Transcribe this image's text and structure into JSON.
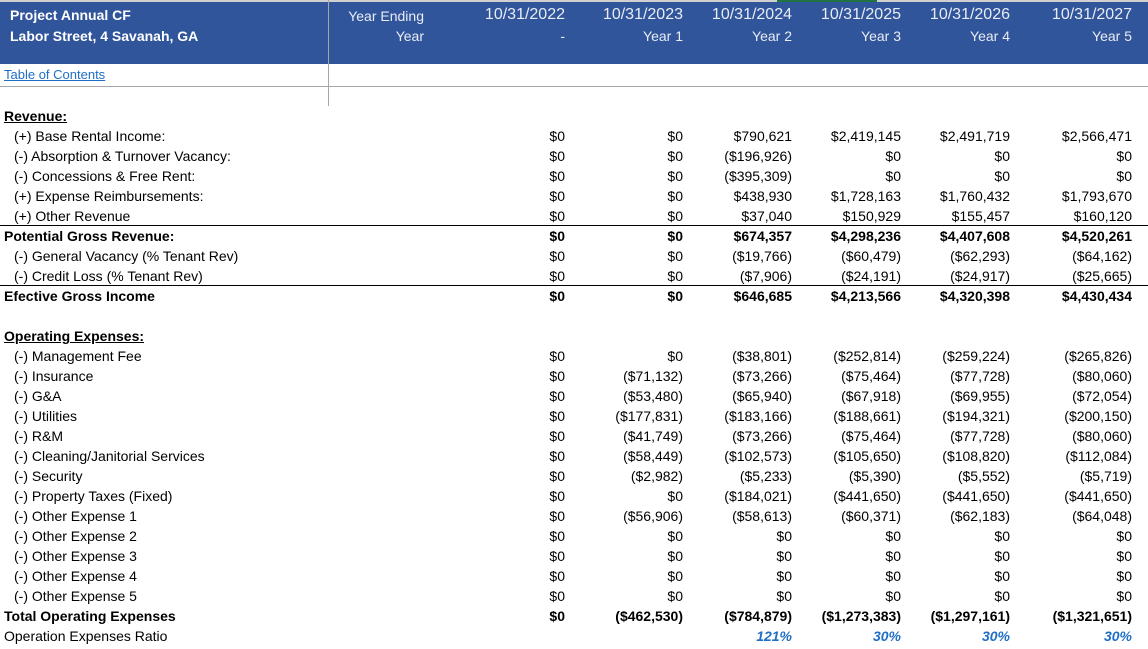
{
  "header": {
    "title": "Project Annual CF",
    "subtitle": "Labor Street, 4 Savanah, GA",
    "year_ending_label": "Year Ending",
    "year_label": "Year",
    "columns": [
      {
        "date": "10/31/2022",
        "year": "-"
      },
      {
        "date": "10/31/2023",
        "year": "Year 1"
      },
      {
        "date": "10/31/2024",
        "year": "Year 2"
      },
      {
        "date": "10/31/2025",
        "year": "Year 3"
      },
      {
        "date": "10/31/2026",
        "year": "Year 4"
      },
      {
        "date": "10/31/2027",
        "year": "Year 5"
      }
    ]
  },
  "toc_link": "Table of Contents",
  "accent_color": "#31559a",
  "rows": [
    {
      "label": "",
      "values": []
    },
    {
      "label": "Revenue:",
      "style": "section",
      "values": []
    },
    {
      "label": "(+) Base Rental Income:",
      "indent": true,
      "values": [
        "$0",
        "$0",
        "$790,621",
        "$2,419,145",
        "$2,491,719",
        "$2,566,471"
      ]
    },
    {
      "label": "(-) Absorption & Turnover Vacancy:",
      "indent": true,
      "values": [
        "$0",
        "$0",
        "($196,926)",
        "$0",
        "$0",
        "$0"
      ]
    },
    {
      "label": "(-) Concessions & Free Rent:",
      "indent": true,
      "values": [
        "$0",
        "$0",
        "($395,309)",
        "$0",
        "$0",
        "$0"
      ]
    },
    {
      "label": "(+) Expense Reimbursements:",
      "indent": true,
      "values": [
        "$0",
        "$0",
        "$438,930",
        "$1,728,163",
        "$1,760,432",
        "$1,793,670"
      ]
    },
    {
      "label": "(+) Other Revenue",
      "indent": true,
      "values": [
        "$0",
        "$0",
        "$37,040",
        "$150,929",
        "$155,457",
        "$160,120"
      ]
    },
    {
      "label": "Potential Gross Revenue:",
      "style": "total",
      "values": [
        "$0",
        "$0",
        "$674,357",
        "$4,298,236",
        "$4,407,608",
        "$4,520,261"
      ]
    },
    {
      "label": "(-) General Vacancy (% Tenant Rev)",
      "indent": true,
      "values": [
        "$0",
        "$0",
        "($19,766)",
        "($60,479)",
        "($62,293)",
        "($64,162)"
      ]
    },
    {
      "label": "(-) Credit Loss (% Tenant Rev)",
      "indent": true,
      "values": [
        "$0",
        "$0",
        "($7,906)",
        "($24,191)",
        "($24,917)",
        "($25,665)"
      ]
    },
    {
      "label": "Efective Gross Income",
      "style": "total",
      "values": [
        "$0",
        "$0",
        "$646,685",
        "$4,213,566",
        "$4,320,398",
        "$4,430,434"
      ]
    },
    {
      "label": "",
      "values": []
    },
    {
      "label": "Operating Expenses:",
      "style": "section",
      "values": []
    },
    {
      "label": "(-) Management Fee",
      "indent": true,
      "values": [
        "$0",
        "$0",
        "($38,801)",
        "($252,814)",
        "($259,224)",
        "($265,826)"
      ]
    },
    {
      "label": "(-) Insurance",
      "indent": true,
      "values": [
        "$0",
        "($71,132)",
        "($73,266)",
        "($75,464)",
        "($77,728)",
        "($80,060)"
      ]
    },
    {
      "label": "(-) G&A",
      "indent": true,
      "values": [
        "$0",
        "($53,480)",
        "($65,940)",
        "($67,918)",
        "($69,955)",
        "($72,054)"
      ]
    },
    {
      "label": "(-) Utilities",
      "indent": true,
      "values": [
        "$0",
        "($177,831)",
        "($183,166)",
        "($188,661)",
        "($194,321)",
        "($200,150)"
      ]
    },
    {
      "label": "(-) R&M",
      "indent": true,
      "values": [
        "$0",
        "($41,749)",
        "($73,266)",
        "($75,464)",
        "($77,728)",
        "($80,060)"
      ]
    },
    {
      "label": "(-) Cleaning/Janitorial Services",
      "indent": true,
      "values": [
        "$0",
        "($58,449)",
        "($102,573)",
        "($105,650)",
        "($108,820)",
        "($112,084)"
      ]
    },
    {
      "label": "(-) Security",
      "indent": true,
      "values": [
        "$0",
        "($2,982)",
        "($5,233)",
        "($5,390)",
        "($5,552)",
        "($5,719)"
      ]
    },
    {
      "label": "(-) Property Taxes (Fixed)",
      "indent": true,
      "values": [
        "$0",
        "$0",
        "($184,021)",
        "($441,650)",
        "($441,650)",
        "($441,650)"
      ]
    },
    {
      "label": "(-) Other Expense 1",
      "indent": true,
      "values": [
        "$0",
        "($56,906)",
        "($58,613)",
        "($60,371)",
        "($62,183)",
        "($64,048)"
      ]
    },
    {
      "label": "(-) Other Expense 2",
      "indent": true,
      "values": [
        "$0",
        "$0",
        "$0",
        "$0",
        "$0",
        "$0"
      ]
    },
    {
      "label": "(-) Other Expense 3",
      "indent": true,
      "values": [
        "$0",
        "$0",
        "$0",
        "$0",
        "$0",
        "$0"
      ]
    },
    {
      "label": "(-) Other Expense 4",
      "indent": true,
      "values": [
        "$0",
        "$0",
        "$0",
        "$0",
        "$0",
        "$0"
      ]
    },
    {
      "label": "(-) Other Expense 5",
      "indent": true,
      "values": [
        "$0",
        "$0",
        "$0",
        "$0",
        "$0",
        "$0"
      ]
    },
    {
      "label": "Total Operating Expenses",
      "style": "bold",
      "values": [
        "$0",
        "($462,530)",
        "($784,879)",
        "($1,273,383)",
        "($1,297,161)",
        "($1,321,651)"
      ]
    },
    {
      "label": "Operation Expenses Ratio",
      "style": "pct",
      "values": [
        "",
        "",
        "121%",
        "30%",
        "30%",
        "30%"
      ]
    }
  ]
}
